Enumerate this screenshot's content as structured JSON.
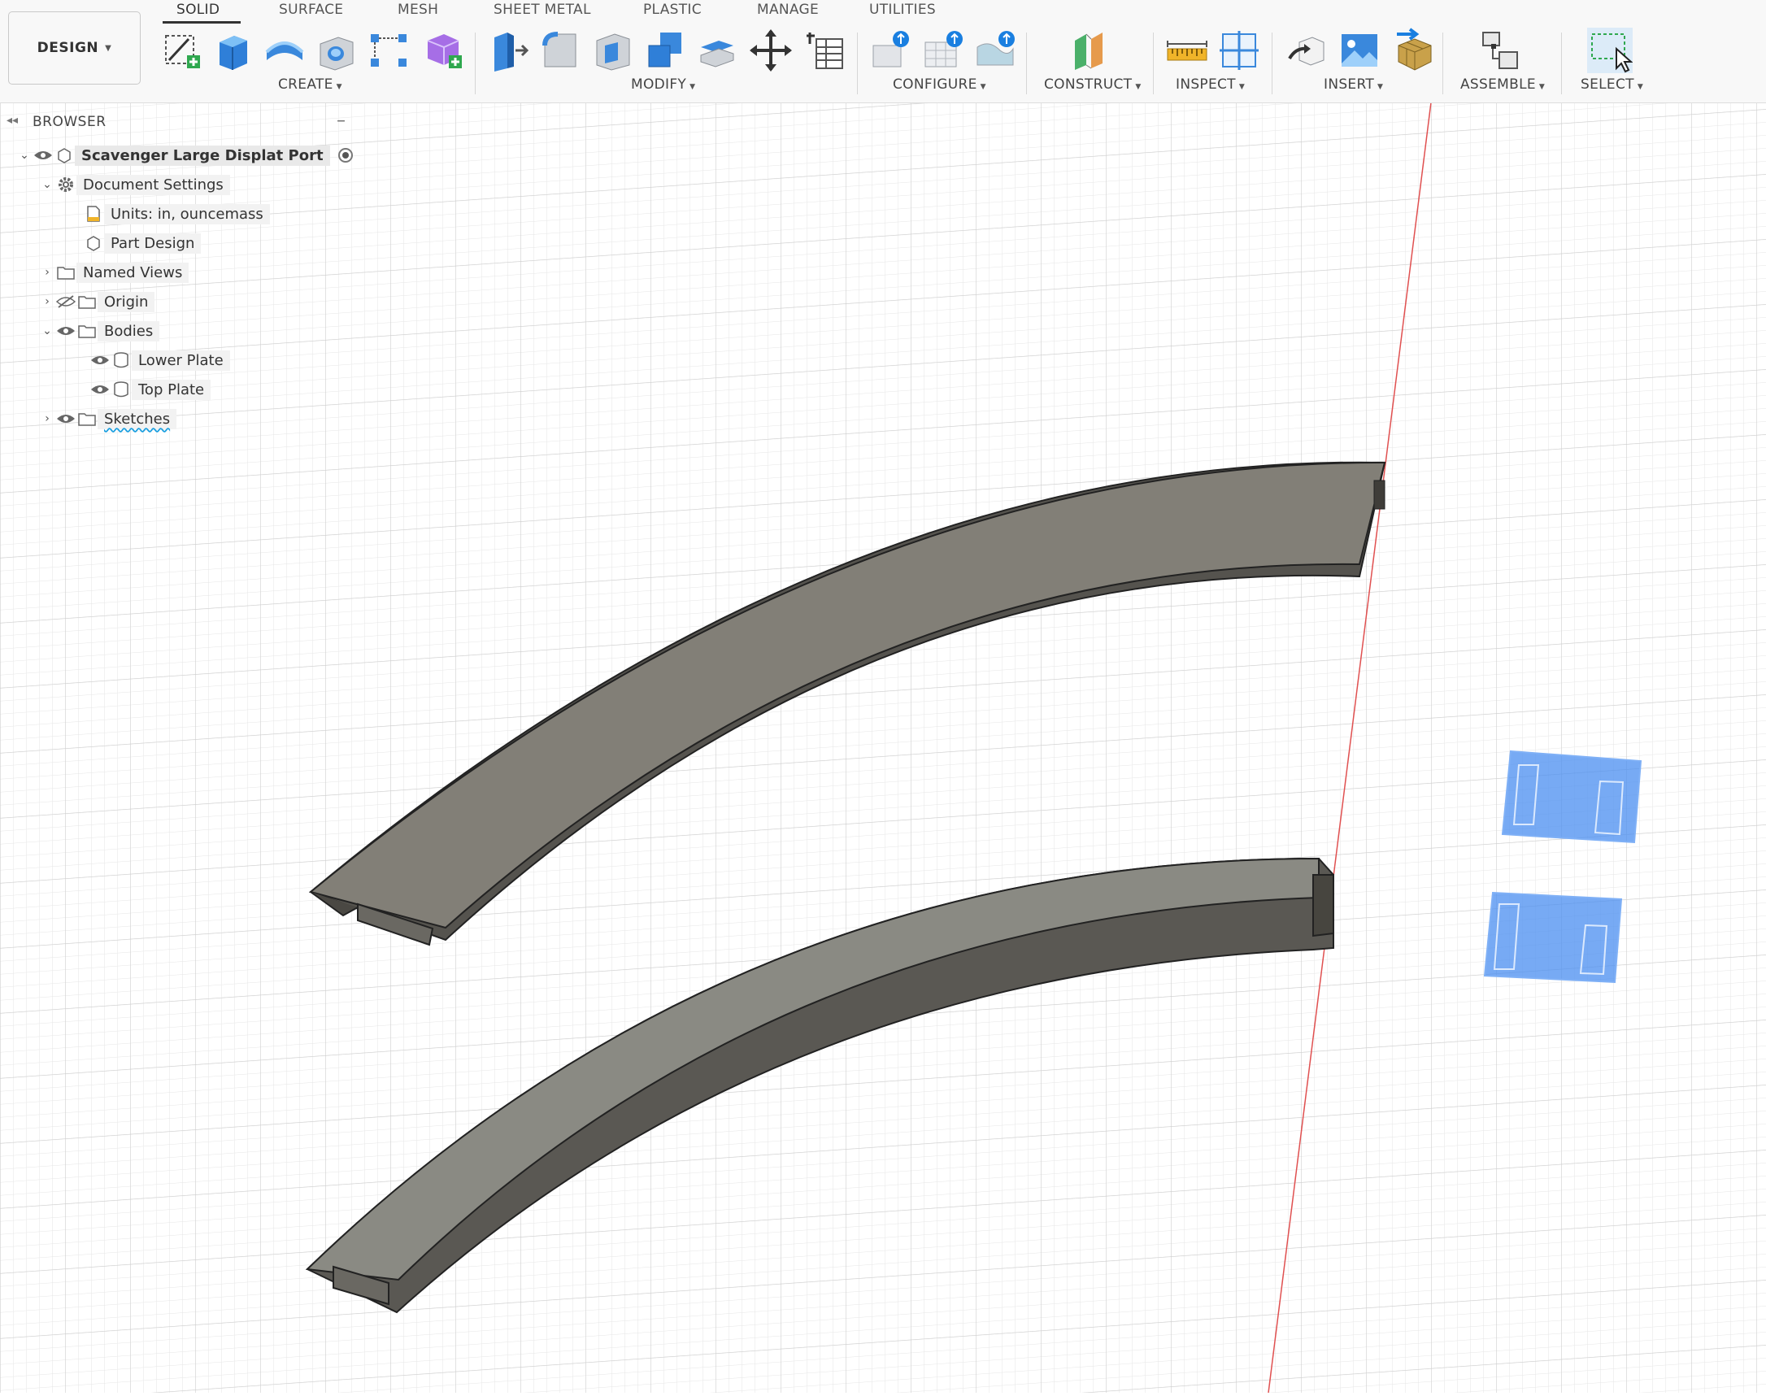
{
  "workspace": {
    "label": "DESIGN"
  },
  "tabs": [
    {
      "label": "SOLID",
      "active": true
    },
    {
      "label": "SURFACE"
    },
    {
      "label": "MESH"
    },
    {
      "label": "SHEET METAL"
    },
    {
      "label": "PLASTIC"
    },
    {
      "label": "MANAGE"
    },
    {
      "label": "UTILITIES"
    }
  ],
  "groups": [
    {
      "label": "CREATE"
    },
    {
      "label": "MODIFY"
    },
    {
      "label": "CONFIGURE"
    },
    {
      "label": "CONSTRUCT"
    },
    {
      "label": "INSPECT"
    },
    {
      "label": "INSERT"
    },
    {
      "label": "ASSEMBLE"
    },
    {
      "label": "SELECT"
    }
  ],
  "tools": [
    "create-sketch-icon",
    "extrude-icon",
    "revolve-icon",
    "hole-icon",
    "pattern-icon",
    "create-form-icon",
    "press-pull-icon",
    "fillet-icon",
    "shell-icon",
    "combine-icon",
    "offset-face-icon",
    "move-icon",
    "parameters-icon",
    "configure-table-icon",
    "configure-grid-icon",
    "configure-theme-icon",
    "offset-plane-icon",
    "measure-icon",
    "section-analysis-icon",
    "insert-derive-icon",
    "insert-canvas-icon",
    "insert-mesh-icon",
    "joint-icon",
    "select-window-icon"
  ],
  "browser": {
    "title": "BROWSER",
    "root": {
      "label": "Scavenger Large Displat Port"
    },
    "document_settings": {
      "label": "Document Settings"
    },
    "units": {
      "label": "Units: in, ouncemass"
    },
    "part_design": {
      "label": "Part Design"
    },
    "named_views": {
      "label": "Named Views"
    },
    "origin": {
      "label": "Origin"
    },
    "bodies": {
      "label": "Bodies"
    },
    "lower_plate": {
      "label": "Lower Plate"
    },
    "top_plate": {
      "label": "Top Plate"
    },
    "sketches": {
      "label": "Sketches"
    }
  },
  "colors": {
    "toolbar_bg": "#f8f8f8",
    "grid_minor": "#e6e6e6",
    "grid_major": "#cfcfcf",
    "axis_red": "#e05050",
    "body_top": "#7f7c74",
    "body_side": "#55534e",
    "sketch_blue": "#4a8df0"
  }
}
